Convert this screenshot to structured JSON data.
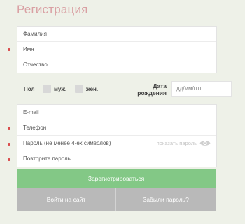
{
  "page": {
    "title": "Регистрация"
  },
  "name_fields": [
    {
      "placeholder": "Фамилия"
    },
    {
      "placeholder": "Имя"
    },
    {
      "placeholder": "Отчество"
    }
  ],
  "gender": {
    "label": "Пол",
    "male": "муж.",
    "female": "жен."
  },
  "birthdate": {
    "label": "Дата рождения",
    "placeholder": "дд/мм/гггг"
  },
  "account_fields": {
    "email": "E-mail",
    "phone": "Телефон",
    "password": "Пароль (не менее 4-ех символов)",
    "show_password": "показать пароль",
    "repeat_password": "Повторите пароль"
  },
  "buttons": {
    "register": "Зарегистрироваться",
    "login": "Войти на сайт",
    "forgot": "Забыли пароль?"
  },
  "colors": {
    "title": "#d9a0a3",
    "required_dot": "#d94b4b",
    "register_button": "#83c886",
    "secondary_button": "#b9b9b9"
  },
  "icons": {
    "show_password": "eye-icon"
  }
}
